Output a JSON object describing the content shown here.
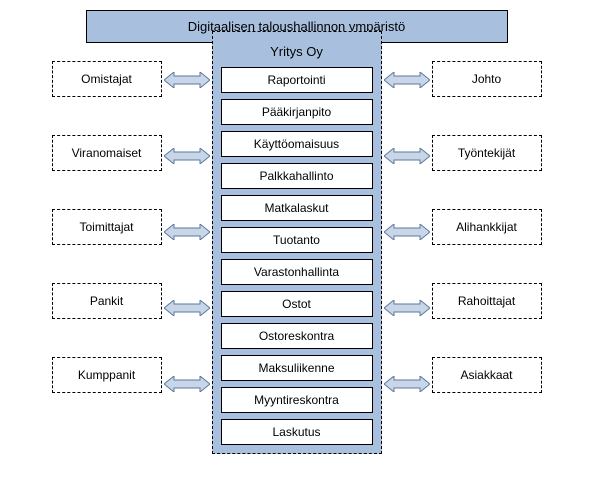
{
  "title": "Digitaalisen taloushallinnon ympäristö",
  "center_title": "Yritys Oy",
  "modules": [
    "Raportointi",
    "Pääkirjanpito",
    "Käyttöomaisuus",
    "Palkkahallinto",
    "Matkalaskut",
    "Tuotanto",
    "Varastonhallinta",
    "Ostot",
    "Ostoreskontra",
    "Maksuliikenne",
    "Myyntireskontra",
    "Laskutus"
  ],
  "left": [
    "Omistajat",
    "Viranomaiset",
    "Toimittajat",
    "Pankit",
    "Kumppanit"
  ],
  "right": [
    "Johto",
    "Työntekijät",
    "Alihankkijat",
    "Rahoittajat",
    "Asiakkaat"
  ],
  "colors": {
    "box_fill": "#a8c0de",
    "arrow_fill": "#c9d6e7",
    "arrow_stroke": "#5a78a0"
  }
}
